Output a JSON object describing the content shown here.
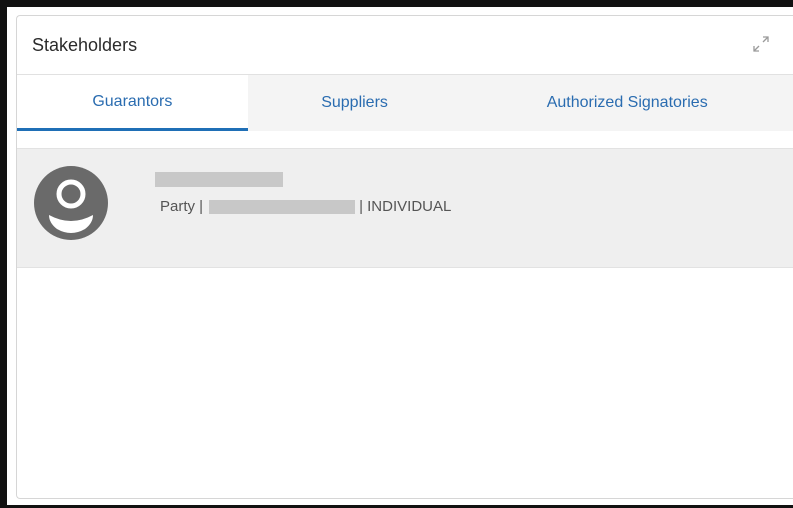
{
  "panel": {
    "title": "Stakeholders",
    "expand_icon": "expand-icon"
  },
  "tabs": [
    {
      "label": "Guarantors",
      "active": true
    },
    {
      "label": "Suppliers",
      "active": false
    },
    {
      "label": "Authorized Signatories",
      "active": false
    }
  ],
  "stakeholder": {
    "avatar_icon": "user-avatar-icon",
    "name": "",
    "party_label": "Party |",
    "party_id": "",
    "separator_type": "| INDIVIDUAL"
  },
  "colors": {
    "accent": "#1f6fb6",
    "tab_text": "#2a6cb0",
    "card_bg": "#efefef"
  }
}
